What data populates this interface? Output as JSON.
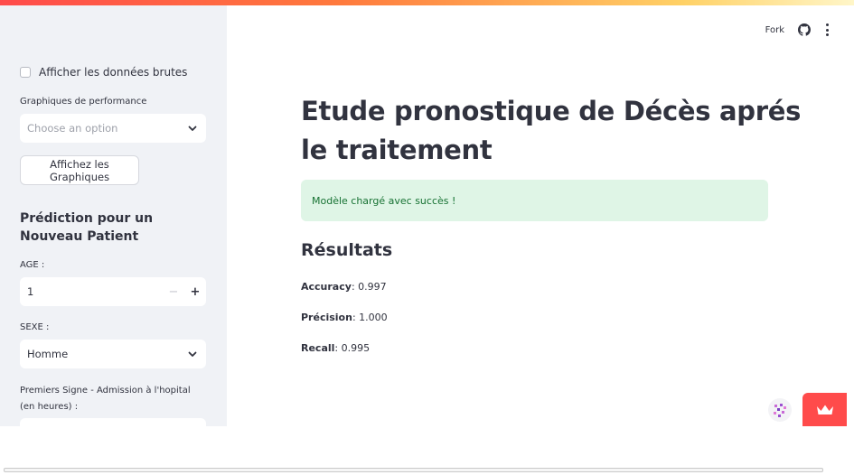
{
  "header": {
    "fork_label": "Fork",
    "github_icon": "github-icon",
    "menu_icon": "more-vertical-icon"
  },
  "sidebar": {
    "raw_data_checkbox": {
      "label": "Afficher les données brutes",
      "checked": false
    },
    "perf_charts": {
      "label": "Graphiques de performance",
      "placeholder": "Choose an option"
    },
    "show_charts_button": "Affichez les Graphiques",
    "prediction_heading": "Prédiction pour un Nouveau Patient",
    "age": {
      "label": "AGE :",
      "value": "1",
      "minus": "−",
      "plus": "+"
    },
    "sexe": {
      "label": "SEXE :",
      "value": "Homme"
    },
    "first_signs": {
      "label": "Premiers Signe - Admission à l'hopital (en heures) :"
    }
  },
  "main": {
    "title": "Etude pronostique de Décès aprés le traitement",
    "success_message": "Modèle chargé avec succès !",
    "results_heading": "Résultats",
    "metrics": [
      {
        "name": "Accuracy",
        "value": ": 0.997"
      },
      {
        "name": "Précision",
        "value": ": 1.000"
      },
      {
        "name": "Recall",
        "value": ": 0.995"
      }
    ]
  },
  "widgets": {
    "fab_icon": "pixel-logo-icon",
    "crown_icon": "crown-icon"
  },
  "colors": {
    "accent": "#ff4b4b",
    "sidebar_bg": "#f0f2f6",
    "success_bg": "#dff5e6",
    "success_text": "#177233",
    "text": "#31333f"
  }
}
